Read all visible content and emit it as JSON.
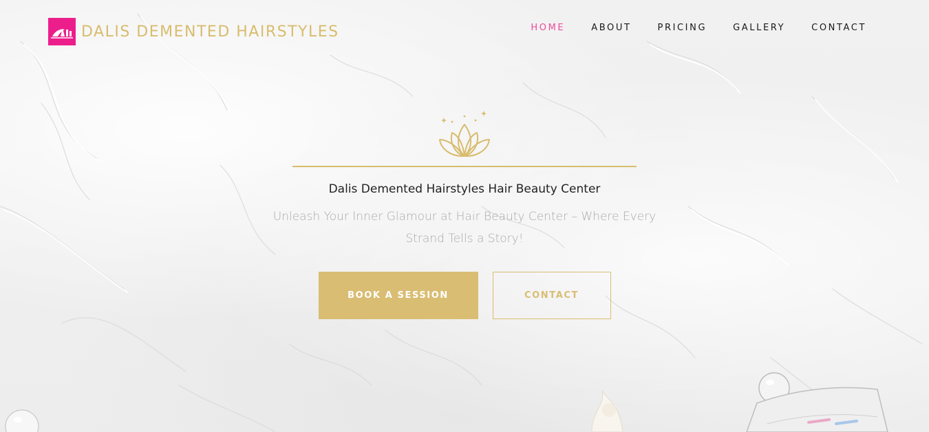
{
  "brand": {
    "name": "DALIS DEMENTED HAIRSTYLES",
    "logo_color": "#ec1e8c",
    "text_color": "#d8bc6d"
  },
  "nav": {
    "items": [
      {
        "label": "HOME",
        "active": true
      },
      {
        "label": "ABOUT",
        "active": false
      },
      {
        "label": "PRICING",
        "active": false
      },
      {
        "label": "GALLERY",
        "active": false
      },
      {
        "label": "CONTACT",
        "active": false
      }
    ],
    "active_color": "#ea4c9b"
  },
  "hero": {
    "icon": "lotus-icon",
    "title": "Dalis Demented Hairstyles Hair Beauty Center",
    "subtitle": "Unleash Your Inner Glamour at Hair Beauty Center – Where Every Strand Tells a Story!",
    "primary_button": "BOOK A SESSION",
    "secondary_button": "CONTACT",
    "accent_color": "#d9bd73"
  }
}
